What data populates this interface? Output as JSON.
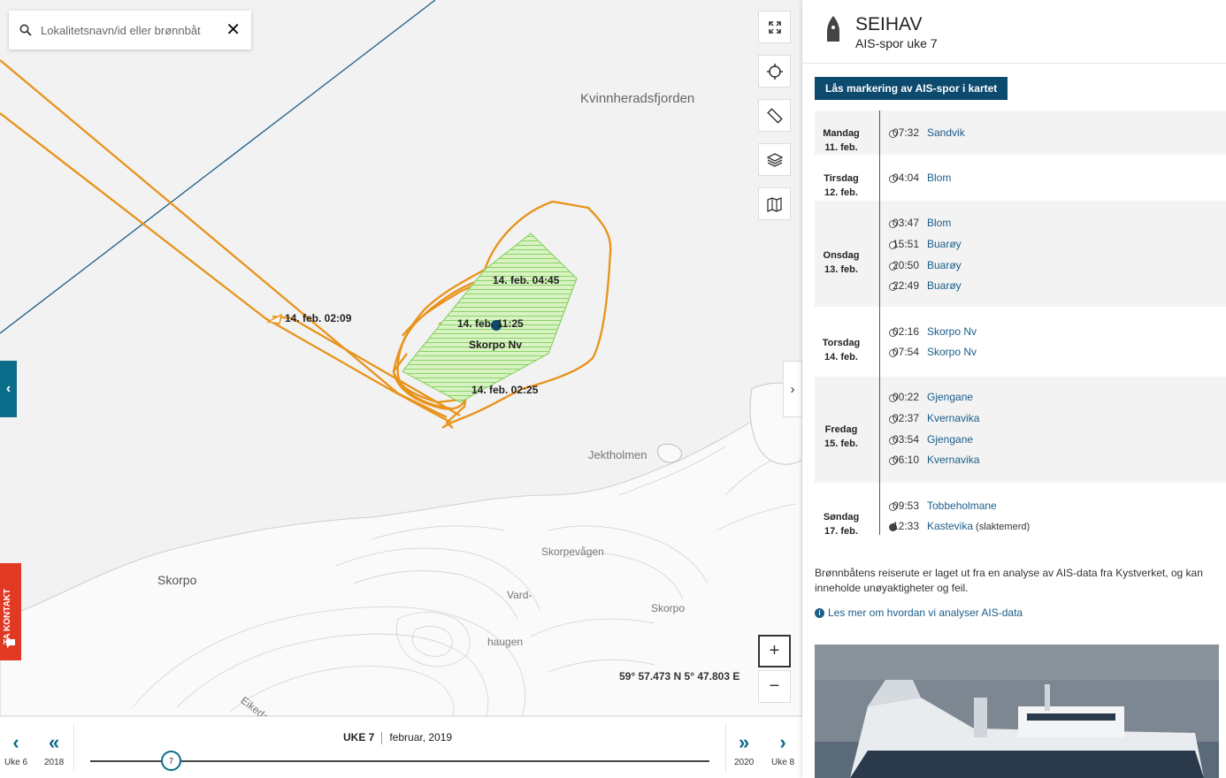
{
  "search": {
    "placeholder": "Lokalitetsnavn/id eller brønnbåt"
  },
  "map": {
    "labels": {
      "kvinnherad": "Kvinnheradsfjorden",
      "jektholmen": "Jektholmen",
      "skorpo_west": "Skorpo",
      "skorpevagen": "Skorpevågen",
      "vard": "Vard-",
      "haugen": "haugen",
      "skorpo_east": "Skorpo",
      "eikedal": "Eikedale"
    },
    "zone_label": "Skorpo Nv",
    "track_labels": {
      "a": "14. feb. 02:09",
      "b": "14. feb. 04:45",
      "c": "14. feb. 11:25",
      "d": "14. feb. 02:25"
    },
    "coordinates": "59° 57.473 N 5° 47.803 E",
    "colors": {
      "track": "#e8931a",
      "zone_fill": "#b9e59a",
      "zone_stroke": "#7ccf55",
      "route": "#1a5e8a"
    }
  },
  "tools": {
    "fullscreen": "fullscreen-icon",
    "locate": "crosshair-icon",
    "measure": "ruler-icon",
    "layers": "layers-icon",
    "maps": "map-help-icon",
    "zoom_in": "+",
    "zoom_out": "−"
  },
  "contact_tab": "TA KONTAKT",
  "timeline": {
    "prev_week": "Uke 6",
    "prev_year": "2018",
    "next_year": "2020",
    "next_week": "Uke 8",
    "week": "UKE 7",
    "month": "februar, 2019",
    "handle_value": "7"
  },
  "panel": {
    "vessel_name": "SEIHAV",
    "subtitle": "AIS-spor uke 7",
    "lock_button": "Lås markering av AIS-spor i kartet",
    "days": [
      {
        "day": "Mandag",
        "date": "11. feb.",
        "entries": [
          {
            "time": "07:32",
            "location": "Sandvik"
          }
        ]
      },
      {
        "day": "Tirsdag",
        "date": "12. feb.",
        "entries": [
          {
            "time": "04:04",
            "location": "Blom"
          }
        ]
      },
      {
        "day": "Onsdag",
        "date": "13. feb.",
        "entries": [
          {
            "time": "03:47",
            "location": "Blom"
          },
          {
            "time": "15:51",
            "location": "Buarøy"
          },
          {
            "time": "20:50",
            "location": "Buarøy"
          },
          {
            "time": "22:49",
            "location": "Buarøy"
          }
        ]
      },
      {
        "day": "Torsdag",
        "date": "14. feb.",
        "entries": [
          {
            "time": "02:16",
            "location": "Skorpo Nv"
          },
          {
            "time": "07:54",
            "location": "Skorpo Nv"
          }
        ]
      },
      {
        "day": "Fredag",
        "date": "15. feb.",
        "entries": [
          {
            "time": "00:22",
            "location": "Gjengane"
          },
          {
            "time": "02:37",
            "location": "Kvernavika"
          },
          {
            "time": "03:54",
            "location": "Gjengane"
          },
          {
            "time": "06:10",
            "location": "Kvernavika"
          }
        ]
      },
      {
        "day": "Søndag",
        "date": "17. feb.",
        "entries": [
          {
            "time": "09:53",
            "location": "Tobbeholmane"
          },
          {
            "time": "12:33",
            "location": "Kastevika",
            "note": "(slaktemerd)"
          }
        ]
      }
    ],
    "disclaimer": "Brønnbåtens reiserute er laget ut fra en analyse av AIS-data fra Kystverket, og kan inneholde unøyaktigheter og feil.",
    "learn_more": "Les mer om hvordan vi analyser AIS-data"
  }
}
